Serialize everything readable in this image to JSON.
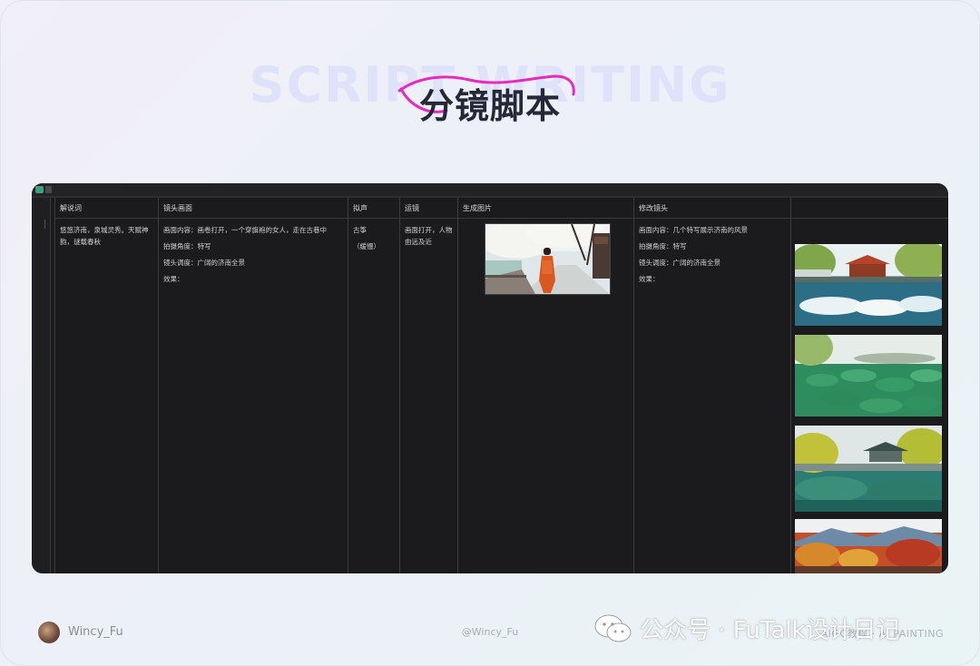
{
  "header": {
    "bg_title": "SCRIPT WRITING",
    "title": "分镜脚本"
  },
  "table": {
    "columns": [
      "解说词",
      "镜头画面",
      "拟声",
      "运镜",
      "生成图片",
      "修改镜头",
      ""
    ],
    "row": {
      "narration": "悠悠济南，泉城灵秀。天赋神韵，谜载春秋",
      "shot": [
        "画面内容：画卷打开，一个穿旗袍的女人，走在古巷中",
        "拍摄角度：特写",
        "镜头调度：广阔的济南全景",
        "效果："
      ],
      "sound": [
        "古筝",
        "（缓慢）"
      ],
      "camera": "画面打开，人物由远及近",
      "image": "woman-in-qipao-image",
      "revised_shot": [
        "画面内容：几个特写展示济南的风景",
        "拍摄角度：特写",
        "镜头调度：广阔的济南全景",
        "效果："
      ],
      "thumbnails": [
        "pavilion-spring-image",
        "lotus-pond-image",
        "green-pavilion-lake-image",
        "autumn-mountain-image"
      ]
    }
  },
  "footer": {
    "author": "Wincy_Fu",
    "handle": "@Wincy_Fu",
    "right_label": "AIGC教程 · AI PAINTING",
    "watermark": "公众号 · FuTalk设计日记"
  },
  "colors": {
    "accent_swoosh": "#e62bbd",
    "window_bg": "#1b1b1d",
    "title": "#252836"
  }
}
